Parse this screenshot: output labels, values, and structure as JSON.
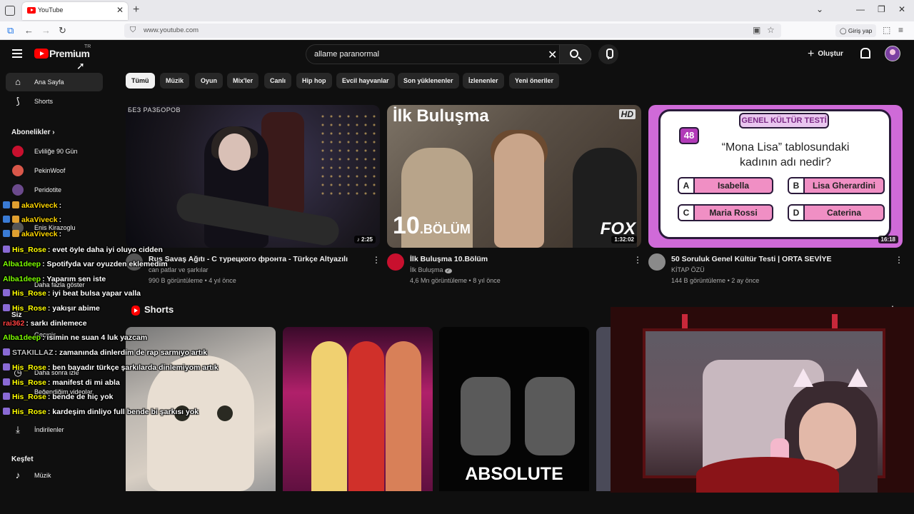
{
  "browser": {
    "tab_title": "YouTube",
    "url": "www.youtube.com",
    "login_label": "Giriş yap"
  },
  "header": {
    "logo_text": "Premium",
    "region": "TR",
    "search_value": "allame paranormal",
    "create_label": "Oluştur"
  },
  "sidebar": {
    "items": [
      {
        "label": "Ana Sayfa",
        "icon": "home-icon"
      },
      {
        "label": "Shorts",
        "icon": "shorts-icon"
      }
    ],
    "subs_heading": "Abonelikler",
    "subs": [
      {
        "label": "Evliliğe 90 Gün",
        "color": "#c8102e"
      },
      {
        "label": "PekinWoof",
        "color": "#d9574a"
      },
      {
        "label": "Peridotite",
        "color": "#6b4a8c"
      },
      {
        "label": "Enis Kirazoglu",
        "color": "#555555"
      }
    ],
    "more_label": "Daha fazla göster",
    "you_heading": "Siz",
    "you_items": [
      {
        "label": "Geçmiş"
      },
      {
        "label": "Daha sonra izle"
      },
      {
        "label": "Beğendiğim videolar"
      },
      {
        "label": "İndirilenler"
      }
    ],
    "explore_heading": "Keşfet",
    "explore_items": [
      {
        "label": "Müzik"
      }
    ]
  },
  "chips": [
    "Tümü",
    "Müzik",
    "Oyun",
    "Mix'ler",
    "Canlı",
    "Hip hop",
    "Evcil hayvanlar",
    "Son yüklenenler",
    "İzlenenler",
    "Yeni öneriler"
  ],
  "videos": [
    {
      "title": "Rus Savaş Ağıtı - С турецкого фронта - Türkçe Altyazılı",
      "channel": "can patlar ve şarkılar",
      "views": "990 B görüntüleme",
      "age": "4 yıl önce",
      "duration": "2:25",
      "thumb_tag": "БЕЗ РАЗБОРОВ",
      "avatar_color": "#555555"
    },
    {
      "title": "İlk Buluşma 10.Bölüm",
      "channel": "İlk Buluşma",
      "verified": "✓",
      "views": "4,6 Mn görüntüleme",
      "age": "8 yıl önce",
      "duration": "1:32:02",
      "thumb_top": "İlk Buluşma",
      "thumb_ep": "10",
      "thumb_ep_suffix": ".BÖLÜM",
      "thumb_net": "FOX",
      "thumb_hd": "HD",
      "avatar_color": "#c8102e"
    },
    {
      "title": "50 Soruluk Genel Kültür Testi | ORTA SEVİYE",
      "channel": "KİTAP ÖZÜ",
      "views": "144 B görüntüleme",
      "age": "2 ay önce",
      "duration": "16:18",
      "quiz_title": "GENEL KÜLTÜR TESTİ",
      "quiz_num": "48",
      "quiz_question": "“Mona Lisa” tablosundaki kadının adı nedir?",
      "options": [
        {
          "key": "A",
          "text": "Isabella"
        },
        {
          "key": "B",
          "text": "Lisa Gherardini"
        },
        {
          "key": "C",
          "text": "Maria Rossi"
        },
        {
          "key": "D",
          "text": "Caterina"
        }
      ],
      "avatar_color": "#8a8a8a"
    }
  ],
  "shorts": {
    "heading": "Shorts",
    "short3_text": "ABSOLUTE"
  },
  "chat": [
    {
      "name": "akaViveck",
      "msg": ":",
      "color": "#ffd700"
    },
    {
      "name": "akaViveck",
      "msg": ":",
      "color": "#ffd700"
    },
    {
      "name": "akaViveck",
      "msg": ":",
      "color": "#ffd700"
    },
    {
      "name": "His_Rose",
      "msg": ": evet öyle daha iyi oluyo cidden",
      "color": "#ffff00"
    },
    {
      "name": "Alba1deep",
      "msg": ": Spotifyda var oyuzden eklemedim",
      "color": "#7cfc00"
    },
    {
      "name": "Alba1deep",
      "msg": ": Yaparım sen iste",
      "color": "#7cfc00"
    },
    {
      "name": "His_Rose",
      "msg": ": iyi beat bulsa yapar valla",
      "color": "#ffff00"
    },
    {
      "name": "His_Rose",
      "msg": ": yakışır abime",
      "color": "#ffff00"
    },
    {
      "name": "rai362",
      "msg": ": sarkı dinlemece",
      "color": "#ff4040"
    },
    {
      "name": "Alba1deep",
      "msg": ": isimin ne suan 4 luk yazcam",
      "color": "#7cfc00"
    },
    {
      "name": "STAKILLAZ",
      "msg": ": zamanında dinlerdim de rap sarmıyo artık",
      "color": "#c0c0c0"
    },
    {
      "name": "His_Rose",
      "msg": ": ben bayadır türkçe şarkılarda dinlemiyom artık",
      "color": "#ffff00"
    },
    {
      "name": "His_Rose",
      "msg": ": manifest di mi abla",
      "color": "#ffff00"
    },
    {
      "name": "His_Rose",
      "msg": ": bende de hiç yok",
      "color": "#ffff00"
    },
    {
      "name": "His_Rose",
      "msg": ": kardeşim dinliyo full bende bi şarkısı yok",
      "color": "#ffff00"
    }
  ]
}
